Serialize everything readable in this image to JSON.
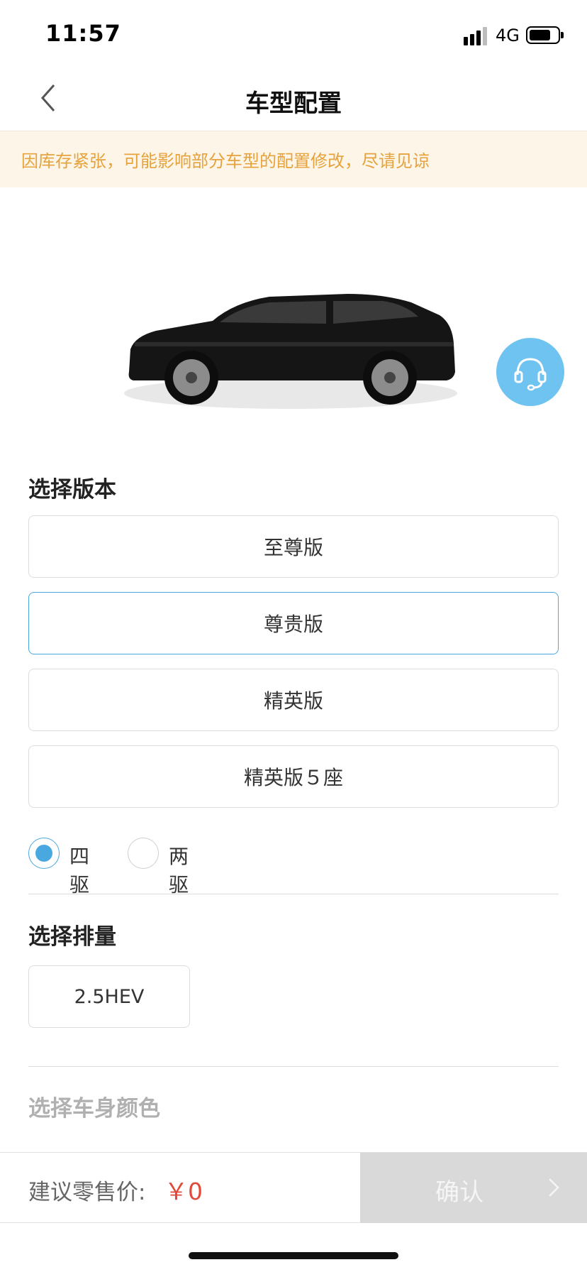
{
  "status_bar": {
    "time": "11:57",
    "network": "4G",
    "battery_level": 0.75
  },
  "nav": {
    "title": "车型配置",
    "back_icon": "chevron-left-icon"
  },
  "notice": {
    "text": "因库存紧张，可能影响部分车型的配置修改，尽请见谅"
  },
  "service_icon": "headset-icon",
  "version_section": {
    "title": "选择版本",
    "options": [
      {
        "label": "至尊版",
        "selected": false
      },
      {
        "label": "尊贵版",
        "selected": true
      },
      {
        "label": "精英版",
        "selected": false
      },
      {
        "label": "精英版５座",
        "selected": false
      }
    ]
  },
  "drive": {
    "options": [
      {
        "label": "四驱",
        "checked": true
      },
      {
        "label": "两驱",
        "checked": false
      }
    ]
  },
  "displacement_section": {
    "title": "选择排量",
    "options": [
      "2.5HEV"
    ]
  },
  "color_section": {
    "title": "选择车身颜色"
  },
  "bottom_bar": {
    "price_label": "建议零售价:",
    "price_value": "￥0",
    "confirm_label": "确认",
    "confirm_icon": "chevron-right-icon"
  },
  "colors": {
    "accent": "#4aa8e0",
    "notice_text": "#e6a23c",
    "notice_bg": "#fdf6e8",
    "price": "#e04a3a",
    "service_bg": "#6fc3f0",
    "confirm_bg": "#d9d9d9"
  }
}
